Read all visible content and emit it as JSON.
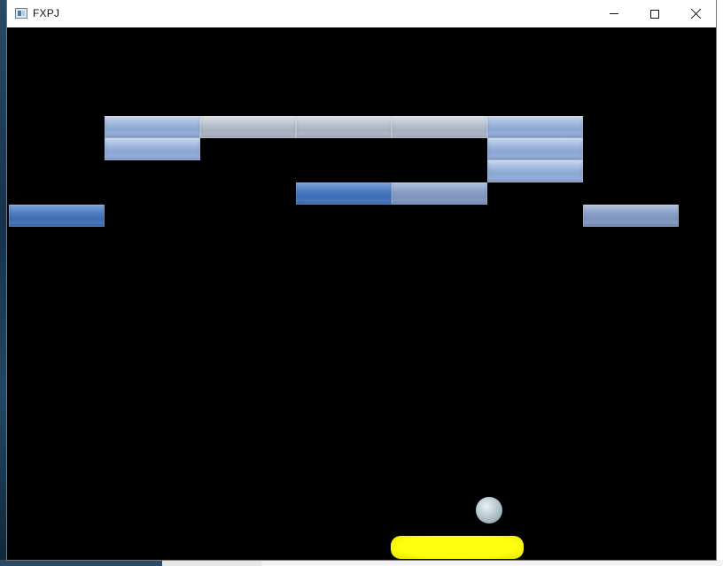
{
  "window": {
    "title": "FXPJ",
    "controls": {
      "minimize_icon": "minimize-icon",
      "maximize_icon": "maximize-icon",
      "close_icon": "close-icon"
    }
  },
  "game": {
    "background_color": "#000000",
    "brick_colors": {
      "light": "#9fb7dc",
      "gray": "#b9c1cd",
      "blue": "#4e7cc2",
      "slate": "#8aa0c8"
    },
    "paddle_color": "#ffff00",
    "ball_color": "#b8c9cf",
    "bricks": [
      {
        "style": "light"
      },
      {
        "style": "gray"
      },
      {
        "style": "gray"
      },
      {
        "style": "gray"
      },
      {
        "style": "light"
      },
      {
        "style": "light"
      },
      {
        "style": "light"
      },
      {
        "style": "light"
      },
      {
        "style": "blue"
      },
      {
        "style": "slate"
      },
      {
        "style": "blue"
      },
      {
        "style": "slate"
      }
    ]
  }
}
